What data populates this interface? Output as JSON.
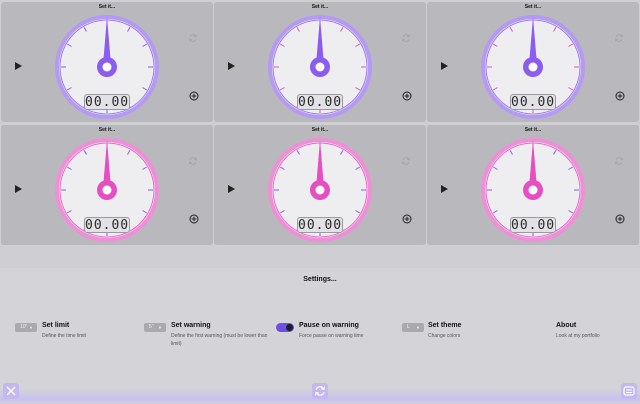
{
  "tiles": [
    {
      "title": "Set it...",
      "time": "00.00",
      "accent": "#8a5cf0"
    },
    {
      "title": "Set it...",
      "time": "00.00",
      "accent": "#8a5cf0"
    },
    {
      "title": "Set it...",
      "time": "00.00",
      "accent": "#8a5cf0"
    },
    {
      "title": "Set it...",
      "time": "00.00",
      "accent": "#e64fc2"
    },
    {
      "title": "Set it...",
      "time": "00.00",
      "accent": "#e64fc2"
    },
    {
      "title": "Set it...",
      "time": "00.00",
      "accent": "#e64fc2"
    }
  ],
  "settings": {
    "title": "Settings...",
    "limit": {
      "value": "10\"",
      "label": "Set limit",
      "desc": "Define the time limit"
    },
    "warning": {
      "value": "5\"",
      "label": "Set warning",
      "desc": "Define the first warning (must be lower than limit)"
    },
    "pause": {
      "label": "Pause on warning",
      "desc": "Force pause on warning time",
      "enabled": true
    },
    "theme": {
      "value": "L",
      "label": "Set theme",
      "desc": "Change colors"
    },
    "about": {
      "label": "About",
      "desc": "Look at my portfolio"
    }
  },
  "icons": {
    "play": "play-icon",
    "reset": "refresh-icon",
    "add": "add-circle-icon",
    "close": "close-icon",
    "refresh": "refresh-icon",
    "menu": "menu-icon"
  },
  "colors": {
    "violet": "#8a5cf0",
    "pink": "#e64fc2",
    "toggle": "#6d4fe6"
  }
}
